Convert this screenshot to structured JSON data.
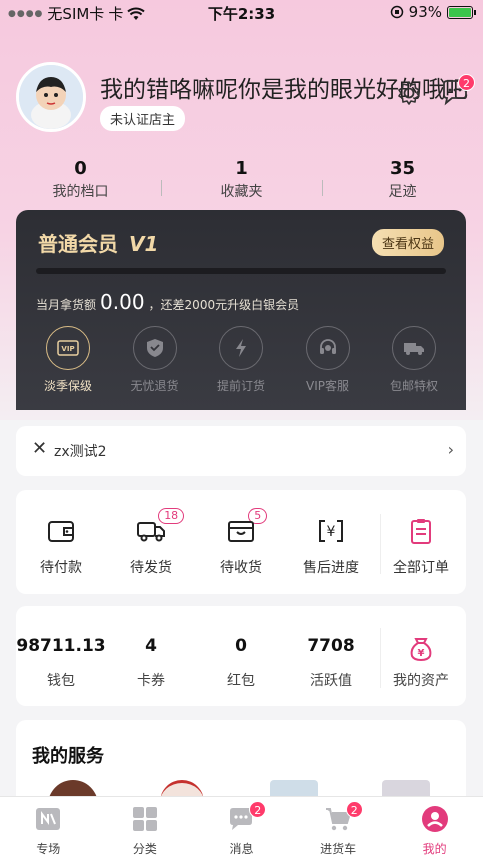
{
  "statusbar": {
    "carrier": "无SIM卡",
    "time": "下午2:33",
    "battery": "93%"
  },
  "profile": {
    "nickname": "我的错咯嘛呢你是我的眼光好的哦吧",
    "cert_label": "未认证店主",
    "message_badge": "2"
  },
  "stats": [
    {
      "num": "0",
      "label": "我的档口"
    },
    {
      "num": "1",
      "label": "收藏夹"
    },
    {
      "num": "35",
      "label": "足迹"
    }
  ],
  "vip": {
    "title": "普通会员",
    "level_mark": "V1",
    "view_btn": "查看权益",
    "month_label": "当月拿货额",
    "month_amount": "0.00",
    "upgrade_text": "，还差2000元升级白银会员",
    "progress": 0,
    "perks": [
      {
        "label": "淡季保级",
        "icon": "vip-card-icon",
        "active": true
      },
      {
        "label": "无忧退货",
        "icon": "shield-icon",
        "active": false
      },
      {
        "label": "提前订货",
        "icon": "lightning-icon",
        "active": false
      },
      {
        "label": "VIP客服",
        "icon": "headset-icon",
        "active": false
      },
      {
        "label": "包邮特权",
        "icon": "truck-icon",
        "active": false
      }
    ]
  },
  "shop_row": {
    "text": "zx测试2"
  },
  "orders": [
    {
      "label": "待付款",
      "icon": "wallet-icon",
      "count": ""
    },
    {
      "label": "待发货",
      "icon": "delivery-truck-icon",
      "count": "18"
    },
    {
      "label": "待收货",
      "icon": "box-icon",
      "count": "5"
    },
    {
      "label": "售后进度",
      "icon": "yuan-service-icon",
      "count": ""
    },
    {
      "label": "全部订单",
      "icon": "clipboard-icon",
      "count": ""
    }
  ],
  "assets": [
    {
      "value": "98711.13",
      "label": "钱包"
    },
    {
      "value": "4",
      "label": "卡券"
    },
    {
      "value": "0",
      "label": "红包"
    },
    {
      "value": "7708",
      "label": "活跃值"
    },
    {
      "value": "",
      "label": "我的资产",
      "icon": "yuan-bag-icon"
    }
  ],
  "services": {
    "title": "我的服务"
  },
  "tabbar": [
    {
      "label": "专场",
      "icon": "special-icon",
      "badge": ""
    },
    {
      "label": "分类",
      "icon": "grid-icon",
      "badge": ""
    },
    {
      "label": "消息",
      "icon": "chat-icon",
      "badge": "2"
    },
    {
      "label": "进货车",
      "icon": "cart-icon",
      "badge": "2"
    },
    {
      "label": "我的",
      "icon": "profile-icon",
      "badge": "",
      "active": true
    }
  ],
  "colors": {
    "accent": "#e23b7c",
    "gold": "#f2d9a8",
    "vip_bg": "#2d2e34"
  }
}
